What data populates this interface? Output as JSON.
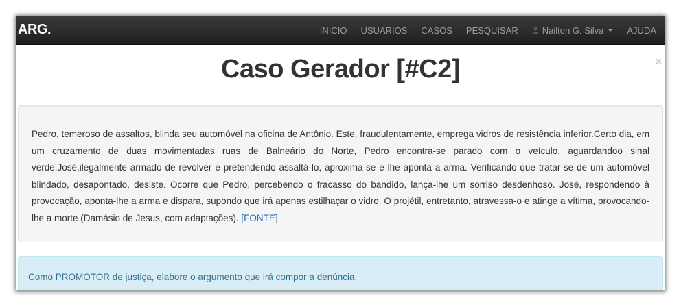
{
  "navbar": {
    "brand": "ARG.",
    "links": [
      "INICIO",
      "USUARIOS",
      "CASOS",
      "PESQUISAR"
    ],
    "user_name": "Nailton G. Silva",
    "help": "AJUDA"
  },
  "modal": {
    "close_symbol": "×",
    "title": "Caso Gerador [#C2]",
    "case_text": "Pedro, temeroso de assaltos, blinda seu automóvel na oficina de Antônio. Este, fraudulentamente, emprega vidros de resistência inferior.Certo dia, em um cruzamento de duas movimentadas ruas de Balneário do Norte, Pedro encontra-se parado com o veículo, aguardandoo sinal verde.José,ilegalmente armado de revólver e pretendendo assaltá-lo, aproxima-se e lhe aponta a arma. Verificando que tratar-se de um automóvel blindado, desapontado, desiste. Ocorre que Pedro, percebendo o fracasso do bandido, lança-lhe um sorriso desdenhoso. José, respondendo à provocação, aponta-lhe a arma e dispara, supondo que irá apenas estilhaçar o vidro. O projétil, entretanto, atravessa-o e atinge a vítima, provocando-lhe a morte (Damásio de Jesus, com adaptações). ",
    "source_link": "[FONTE]",
    "instruction": "Como PROMOTOR de justiça, elabore o argumento que irá compor a denúncia."
  }
}
